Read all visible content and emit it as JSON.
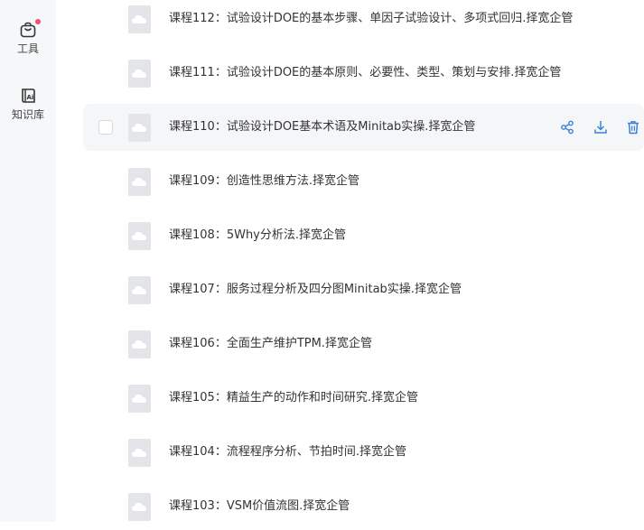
{
  "sidebar": {
    "tools_label": "工具",
    "knowledge_label": "知识库"
  },
  "files": [
    {
      "name": "课程112：试验设计DOE的基本步骤、单因子试验设计、多项式回归.择宽企管"
    },
    {
      "name": "课程111：试验设计DOE的基本原则、必要性、类型、策划与安排.择宽企管"
    },
    {
      "name": "课程110：试验设计DOE基本术语及Minitab实操.择宽企管"
    },
    {
      "name": "课程109：创造性思维方法.择宽企管"
    },
    {
      "name": "课程108：5Why分析法.择宽企管"
    },
    {
      "name": "课程107：服务过程分析及四分图Minitab实操.择宽企管"
    },
    {
      "name": "课程106：全面生产维护TPM.择宽企管"
    },
    {
      "name": "课程105：精益生产的动作和时间研究.择宽企管"
    },
    {
      "name": "课程104：流程程序分析、节拍时间.择宽企管"
    },
    {
      "name": "课程103：VSM价值流图.择宽企管"
    }
  ],
  "colors": {
    "accent": "#3b82d6",
    "badge": "#f0506e",
    "file_icon": "#e3e5e8"
  },
  "icons": {
    "tools": "bag-icon",
    "knowledge": "ai-book-icon",
    "file": "cloud-file-icon",
    "share": "share-icon",
    "download": "download-icon",
    "delete": "trash-icon"
  }
}
